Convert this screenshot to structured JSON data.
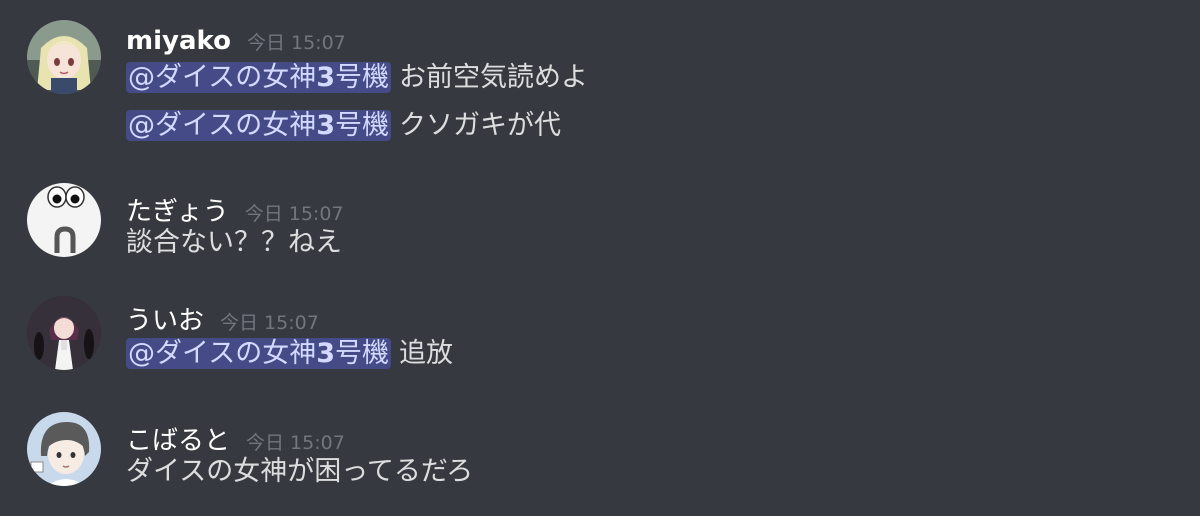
{
  "messages": [
    {
      "username": "miyako",
      "timestamp": "今日 15:07",
      "lines": [
        {
          "mention_pre": "@ダイスの女神",
          "mention_num": "3",
          "mention_post": "号機",
          "text": "お前空気読めよ"
        },
        {
          "mention_pre": "@ダイスの女神",
          "mention_num": "3",
          "mention_post": "号機",
          "text": "クソガキが代"
        }
      ]
    },
    {
      "username": "たぎょう",
      "timestamp": "今日 15:07",
      "lines": [
        {
          "text": "談合ない？？ねえ"
        }
      ]
    },
    {
      "username": "ういお",
      "timestamp": "今日 15:07",
      "lines": [
        {
          "mention_pre": "@ダイスの女神",
          "mention_num": "3",
          "mention_post": "号機",
          "text": "追放"
        }
      ]
    },
    {
      "username": "こばると",
      "timestamp": "今日 15:07",
      "lines": [
        {
          "text": "ダイスの女神が困ってるだろ"
        }
      ]
    }
  ],
  "colors": {
    "background": "#36393f",
    "username": "#ffffff",
    "timestamp": "#72767d",
    "text": "#dcddde",
    "mention_bg": "#444b86",
    "mention_text": "#d4d9ff"
  }
}
